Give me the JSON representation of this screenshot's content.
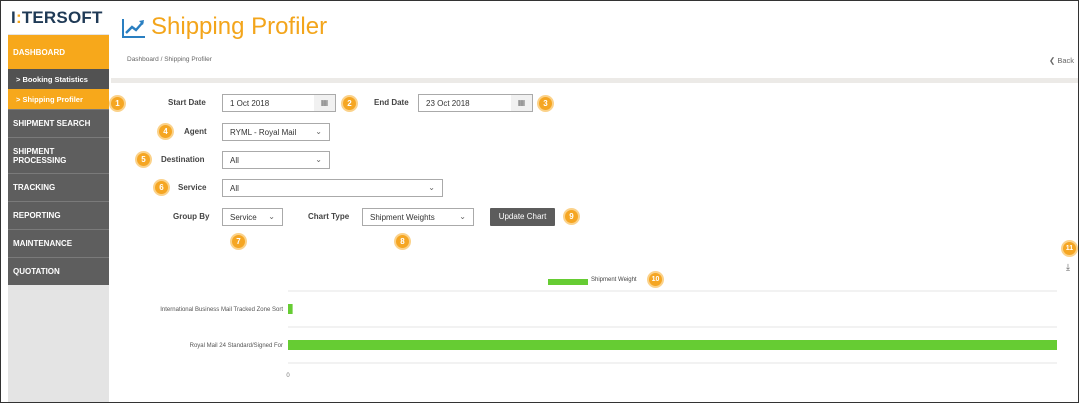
{
  "logo": {
    "text_a": "I",
    "text_b": "̶",
    "full": "I.TERSOFT"
  },
  "sidebar": {
    "dashboard": "DASHBOARD",
    "booking_statistics": "> Booking Statistics",
    "shipping_profiler": "> Shipping Profiler",
    "shipment_search": "SHIPMENT SEARCH",
    "shipment_processing_1": "SHIPMENT",
    "shipment_processing_2": "PROCESSING",
    "tracking": "TRACKING",
    "reporting": "REPORTING",
    "maintenance": "MAINTENANCE",
    "quotation": "QUOTATION"
  },
  "header": {
    "title": "Shipping Profiler",
    "breadcrumb": "Dashboard  /  Shipping Profiler",
    "back": "❮ Back"
  },
  "form": {
    "start_date_label": "Start Date",
    "start_date_value": "1 Oct 2018",
    "end_date_label": "End Date",
    "end_date_value": "23 Oct 2018",
    "agent_label": "Agent",
    "agent_value": "RYML - Royal Mail",
    "destination_label": "Destination",
    "destination_value": "All",
    "service_label": "Service",
    "service_value": "All",
    "group_by_label": "Group By",
    "group_by_value": "Service",
    "chart_type_label": "Chart Type",
    "chart_type_value": "Shipment Weights",
    "update_button": "Update Chart"
  },
  "badges": [
    "1",
    "2",
    "3",
    "4",
    "5",
    "6",
    "7",
    "8",
    "9",
    "10",
    "11"
  ],
  "icons": {
    "calendar": "calendar-icon",
    "chevron": "chevron-down-icon",
    "download": "download-icon",
    "chart": "trend-chart-icon"
  },
  "colors": {
    "accent": "#f7a81b",
    "bar": "#66cc33",
    "sidebar_dark": "#5e5e5e"
  },
  "chart_data": {
    "type": "bar",
    "orientation": "horizontal",
    "categories": [
      "International Business Mail Tracked Zone Sort",
      "Royal Mail 24 Standard/Signed For"
    ],
    "series": [
      {
        "name": "Shipment Weight",
        "values": [
          0.6,
          100
        ]
      }
    ],
    "x_tick_labels": [
      "0"
    ],
    "legend": "top-center"
  }
}
